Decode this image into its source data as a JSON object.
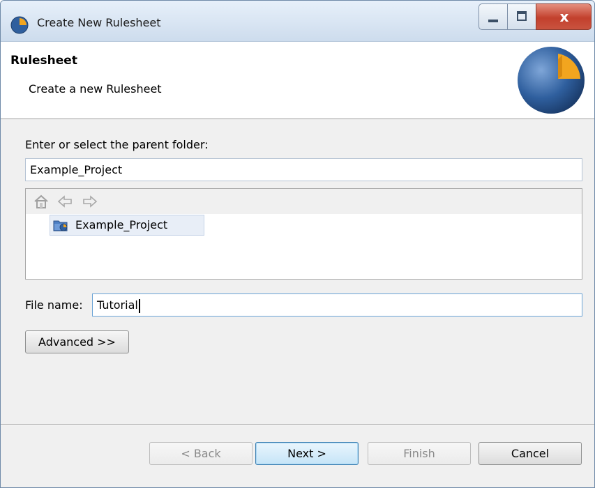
{
  "window": {
    "title": "Create New Rulesheet",
    "close_glyph": "x"
  },
  "banner": {
    "title": "Rulesheet",
    "subtitle": "Create a new Rulesheet"
  },
  "folder": {
    "label": "Enter or select the parent folder:",
    "value": "Example_Project"
  },
  "tree": {
    "toolbar_icons": [
      "home-icon",
      "back-arrow-icon",
      "forward-arrow-icon"
    ],
    "items": [
      {
        "label": "Example_Project",
        "icon": "project-folder-icon",
        "selected": true
      }
    ]
  },
  "file": {
    "label": "File name:",
    "value": "Tutorial"
  },
  "advanced_label": "Advanced >>",
  "buttons": {
    "back": "< Back",
    "next": "Next >",
    "finish": "Finish",
    "cancel": "Cancel"
  },
  "colors": {
    "logo_blue": "#2f5f9e",
    "logo_orange": "#f2a51f",
    "default_button": "#c5e4f7"
  }
}
